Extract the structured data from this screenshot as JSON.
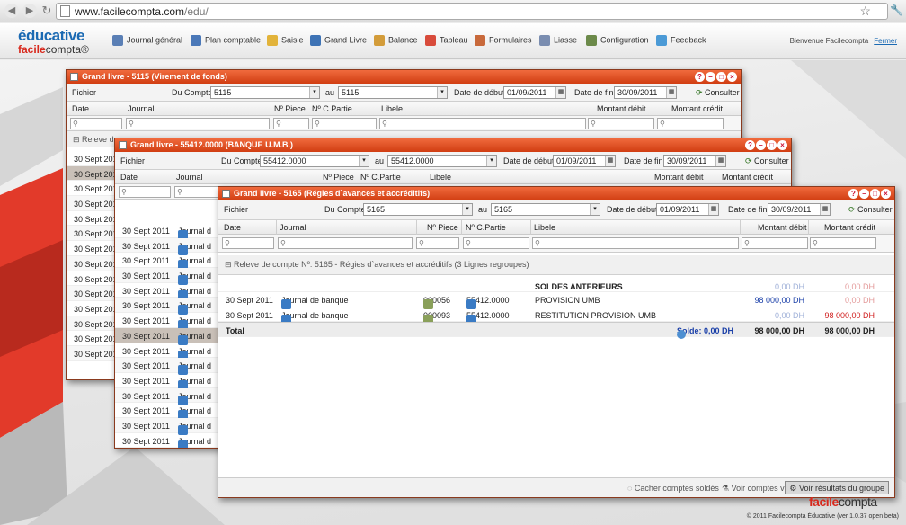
{
  "browser": {
    "url_host": "www.facilecompta.com",
    "url_path": "/edu/"
  },
  "app": {
    "logo_top": "éducative",
    "logo_bottom_a": "facile",
    "logo_bottom_b": "compta",
    "logo_reg": "®"
  },
  "menu": [
    {
      "label": "Journal général",
      "icon": "journal-icon",
      "color": "#5a7fb5"
    },
    {
      "label": "Plan comptable",
      "icon": "plan-icon",
      "color": "#4a78b8"
    },
    {
      "label": "Saisie",
      "icon": "pencil-icon",
      "color": "#e2b33a"
    },
    {
      "label": "Grand Livre",
      "icon": "book-icon",
      "color": "#3e73b5"
    },
    {
      "label": "Balance",
      "icon": "balance-icon",
      "color": "#d39c3a"
    },
    {
      "label": "Tableau",
      "icon": "chart-icon",
      "color": "#d84b3b"
    },
    {
      "label": "Formulaires",
      "icon": "form-icon",
      "color": "#c8693b"
    },
    {
      "label": "Liasse",
      "icon": "liasse-icon",
      "color": "#7a8db0"
    },
    {
      "label": "Configuration",
      "icon": "gear-icon",
      "color": "#6c8a4a"
    },
    {
      "label": "Feedback",
      "icon": "speech-icon",
      "color": "#4b9ad6"
    }
  ],
  "welcome": "Bienvenue Facilecompta",
  "logout": "Fermer",
  "common": {
    "fichier": "Fichier",
    "du_compte": "Du Compte:",
    "au": "au",
    "date_debut": "Date de début:",
    "date_fin": "Date de fin:",
    "consulter": "Consulter",
    "col_date": "Date",
    "col_journal": "Journal",
    "col_piece": "Nº Piece",
    "col_cpartie": "Nº C.Partie",
    "col_libele": "Libele",
    "col_debit": "Montant débit",
    "col_credit": "Montant crédit"
  },
  "win1": {
    "title": "Grand livre - 5115 (Virement de fonds)",
    "from": "5115",
    "to": "5115",
    "start": "01/09/2011",
    "end": "30/09/2011",
    "group": "Releve de",
    "dates": [
      "30 Sept 2011",
      "30 Sept 2011",
      "30 Sept 2011",
      "30 Sept 2011",
      "30 Sept 2011",
      "30 Sept 2011",
      "30 Sept 2011",
      "30 Sept 2011",
      "30 Sept 2011",
      "30 Sept 2011",
      "30 Sept 2011",
      "30 Sept 2011",
      "30 Sept 2011",
      "30 Sept 2011"
    ]
  },
  "win2": {
    "title": "Grand livre - 55412.0000 (BANQUE U.M.B.)",
    "from": "55412.0000",
    "to": "55412.0000",
    "start": "01/09/2011",
    "end": "30/09/2011",
    "journal": "Journal d",
    "dates": [
      "30 Sept 2011",
      "30 Sept 2011",
      "30 Sept 2011",
      "30 Sept 2011",
      "30 Sept 2011",
      "30 Sept 2011",
      "30 Sept 2011",
      "30 Sept 2011",
      "30 Sept 2011",
      "30 Sept 2011",
      "30 Sept 2011",
      "30 Sept 2011",
      "30 Sept 2011",
      "30 Sept 2011",
      "30 Sept 2011"
    ]
  },
  "win3": {
    "title": "Grand livre - 5165 (Régies d`avances et accréditifs)",
    "from": "5165",
    "to": "5165",
    "start": "01/09/2011",
    "end": "30/09/2011",
    "group": "Releve de compte Nº: 5165 - Régies d`avances et accréditifs (3 Lignes regroupes)",
    "soldes_label": "SOLDES ANTERIEURS",
    "soldes_debit": "0,00 DH",
    "soldes_credit": "0,00 DH",
    "rows": [
      {
        "date": "30 Sept 2011",
        "journal": "Journal de banque",
        "piece": "000056",
        "cpartie": "55412.0000",
        "libele": "PROVISION UMB",
        "debit": "98 000,00 DH",
        "credit": "0,00 DH"
      },
      {
        "date": "30 Sept 2011",
        "journal": "Journal de banque",
        "piece": "000093",
        "cpartie": "55412.0000",
        "libele": "RESTITUTION PROVISION UMB",
        "debit": "0,00 DH",
        "credit": "98 000,00 DH"
      }
    ],
    "total_label": "Total",
    "solde": "Solde: 0,00 DH",
    "total_debit": "98 000,00 DH",
    "total_credit": "98 000,00 DH",
    "status": {
      "cacher": "Cacher comptes soldés",
      "vides": "Voir comptes vides",
      "resultats": "Voir résultats du groupe"
    }
  },
  "footer": {
    "logo_a": "facile",
    "logo_b": "compta",
    "copyright": "© 2011 Facilecompta Éducative (ver 1.0.37 open beta)"
  },
  "colors": {
    "title_bar": "#d84a1e",
    "brand_blue": "#1b6ab3",
    "brand_red": "#d8291d",
    "debit_blue": "#1a3fa8",
    "credit_red": "#d01e1e"
  }
}
